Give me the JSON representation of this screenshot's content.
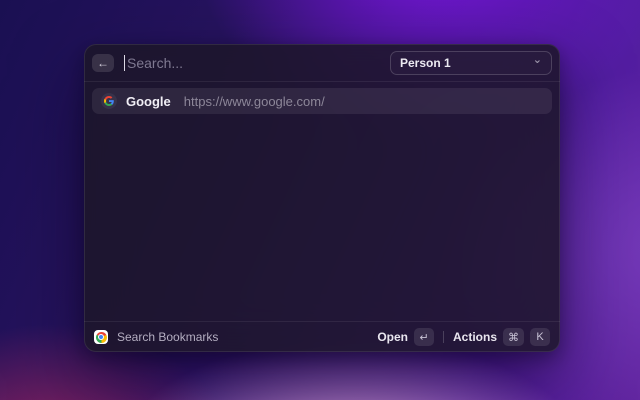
{
  "window": {
    "header": {
      "back_icon": "←",
      "search_placeholder": "Search...",
      "profile": {
        "value": "Person 1",
        "chevron_icon": "⌄"
      }
    },
    "results": [
      {
        "title": "Google",
        "subtitle": "https://www.google.com/"
      }
    ],
    "footer": {
      "command_name": "Search Bookmarks",
      "primary_action": {
        "label": "Open",
        "key": "↵"
      },
      "secondary_action": {
        "label": "Actions",
        "keys": [
          "⌘",
          "K"
        ]
      }
    }
  },
  "colors": {
    "google": {
      "blue": "#4285F4",
      "green": "#34A853",
      "yellow": "#FBBC05",
      "red": "#EA4335"
    },
    "background": {
      "top_left": "#1a1052",
      "top_right": "#7a16e0",
      "right": "#8246c6",
      "bottom_left": "#b22860",
      "bottom_center_glow": "#e2aadc"
    }
  }
}
